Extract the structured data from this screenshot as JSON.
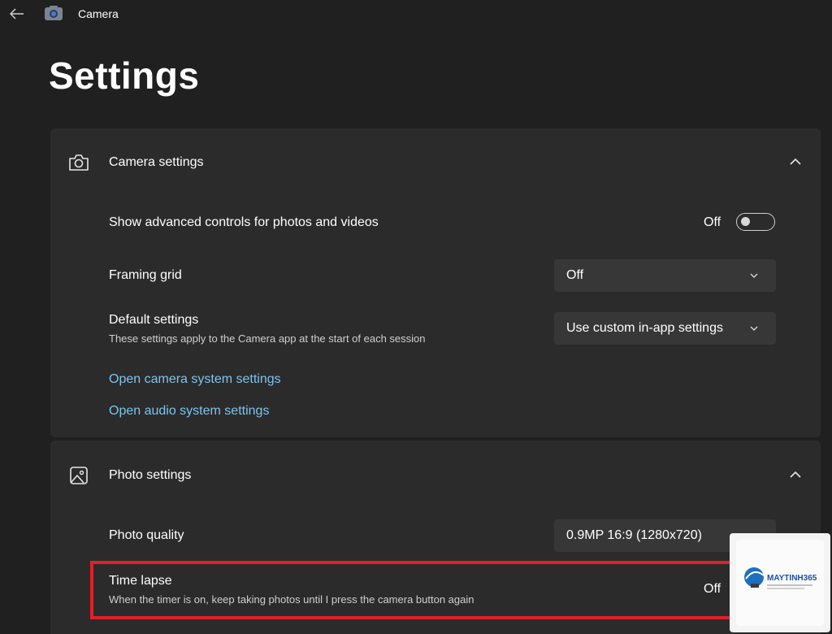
{
  "window": {
    "title": "Camera"
  },
  "page": {
    "title": "Settings"
  },
  "camera_settings": {
    "title": "Camera settings",
    "advanced": {
      "label": "Show advanced controls for photos and videos",
      "state": "Off"
    },
    "framing": {
      "label": "Framing grid",
      "value": "Off"
    },
    "defaults": {
      "label": "Default settings",
      "description": "These settings apply to the Camera app at the start of each session",
      "value": "Use custom in-app settings"
    },
    "links": [
      "Open camera system settings",
      "Open audio system settings"
    ]
  },
  "photo_settings": {
    "title": "Photo settings",
    "quality": {
      "label": "Photo quality",
      "value": "0.9MP 16:9 (1280x720)"
    },
    "time_lapse": {
      "label": "Time lapse",
      "description": "When the timer is on, keep taking photos until I press the camera button again",
      "state": "Off"
    }
  },
  "watermark": {
    "brand": "MAYTINH365"
  },
  "colors": {
    "background": "#202020",
    "card": "#2b2b2b",
    "link": "#7cc4f0",
    "highlight": "#e0202a"
  },
  "icons": [
    "back-arrow-icon",
    "camera-app-icon",
    "camera-icon",
    "chevron-up-icon",
    "chevron-down-icon",
    "photo-icon"
  ]
}
